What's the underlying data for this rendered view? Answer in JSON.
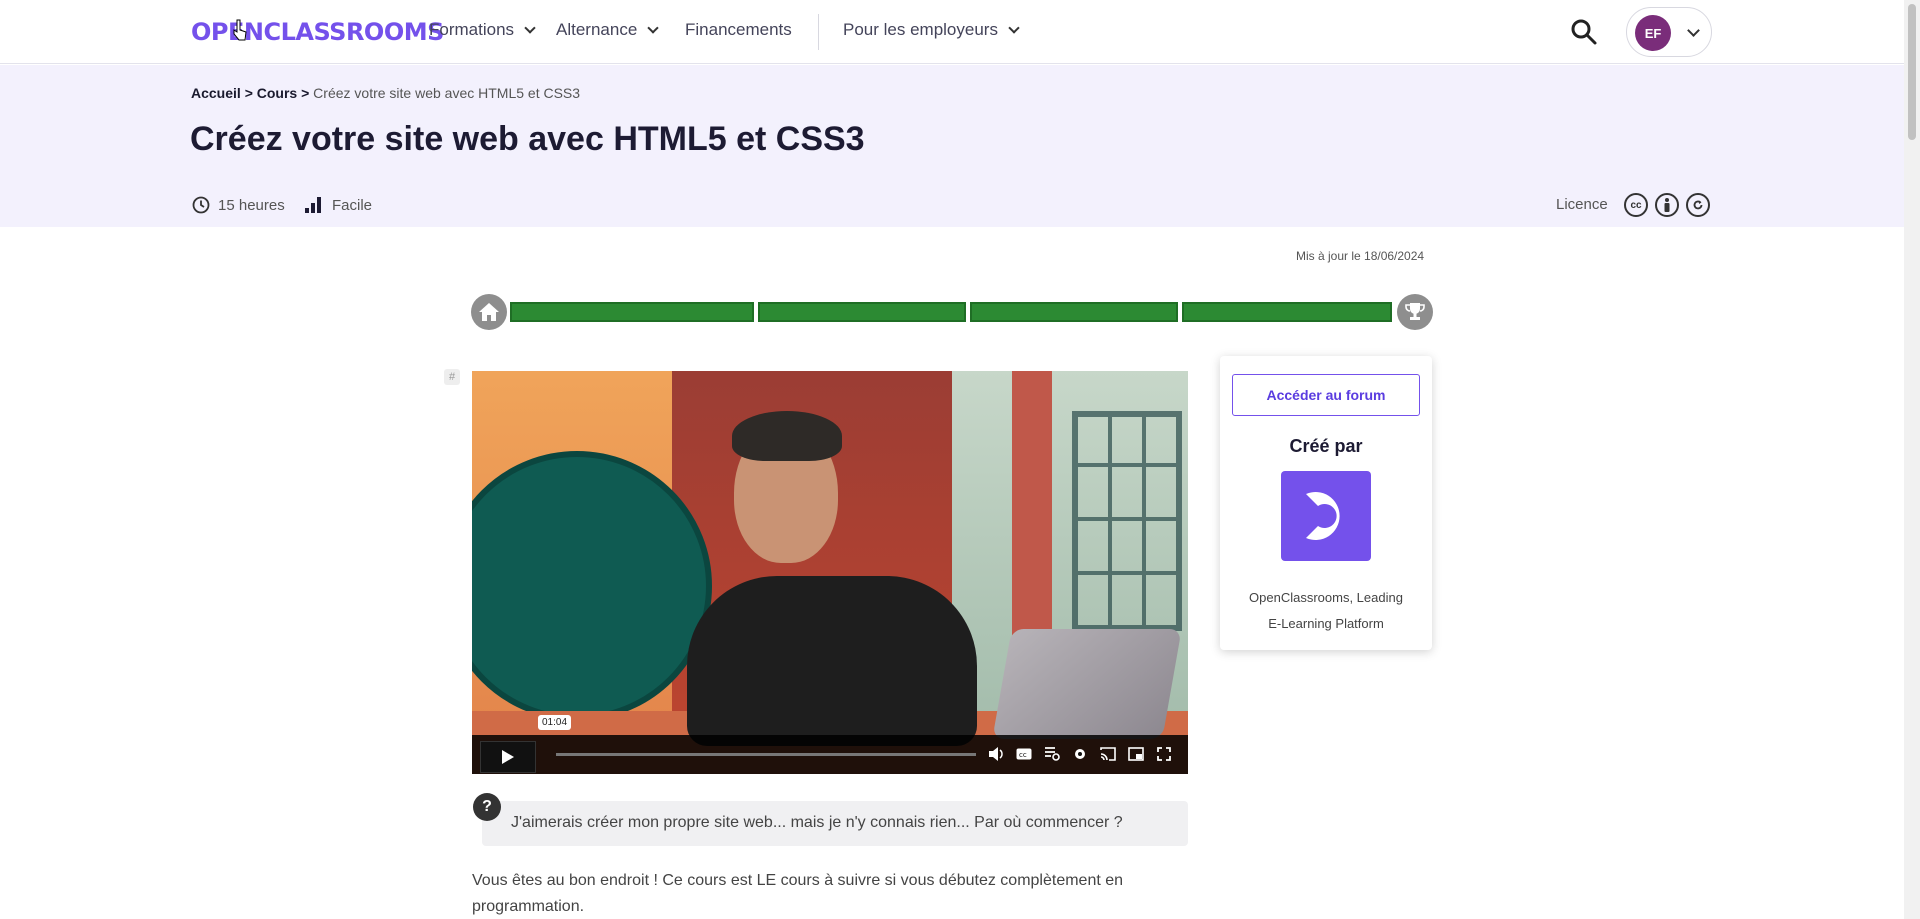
{
  "header": {
    "logo_text": "OPENCLASSROOMS",
    "nav": [
      {
        "label": "Formations",
        "has_dropdown": true
      },
      {
        "label": "Alternance",
        "has_dropdown": true
      },
      {
        "label": "Financements",
        "has_dropdown": false
      },
      {
        "label": "Pour les employeurs",
        "has_dropdown": true
      }
    ],
    "avatar_initials": "EF",
    "brand_color": "#7451eb"
  },
  "breadcrumb": {
    "home": "Accueil >",
    "courses": "Cours >",
    "current": "Créez votre site web avec HTML5 et CSS3"
  },
  "course": {
    "title": "Créez votre site web avec HTML5 et CSS3",
    "duration": "15 heures",
    "difficulty": "Facile",
    "licence_label": "Licence",
    "licence_icons": [
      "creative-commons-icon",
      "attribution-icon",
      "share-alike-icon"
    ],
    "updated": "Mis à jour le 18/06/2024"
  },
  "progress": {
    "segments_complete": 4,
    "segments_total": 4,
    "color": "#2c8a33"
  },
  "video": {
    "timestamp": "01:04"
  },
  "sidebar": {
    "forum_button": "Accéder au forum",
    "created_by": "Créé par",
    "author_line1": "OpenClassrooms, Leading",
    "author_line2": "E-Learning Platform"
  },
  "content": {
    "question": "J'aimerais créer mon propre site web... mais je n'y connais rien... Par où commencer ?",
    "intro": "Vous êtes au bon endroit ! Ce cours est LE cours à suivre si vous débutez complètement en programmation."
  }
}
